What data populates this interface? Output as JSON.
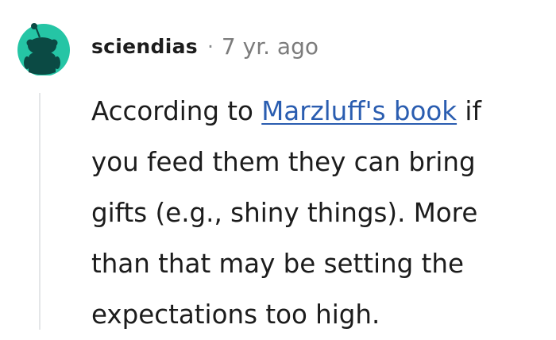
{
  "comment": {
    "username": "sciendias",
    "separator": "·",
    "timestamp": "7 yr. ago",
    "avatar_icon": "reddit-snoo-avatar-icon",
    "avatar_color": "#25c5a5",
    "link_color": "#2a5db0",
    "body": {
      "line1_before_link": "According to ",
      "link_text": "Marzluff's book",
      "line1_after_link": " if",
      "line2": "you feed them they can bring",
      "line3": "gifts (e.g., shiny things). More",
      "line4": "than that may be setting the",
      "line5": "expectations too high."
    }
  }
}
